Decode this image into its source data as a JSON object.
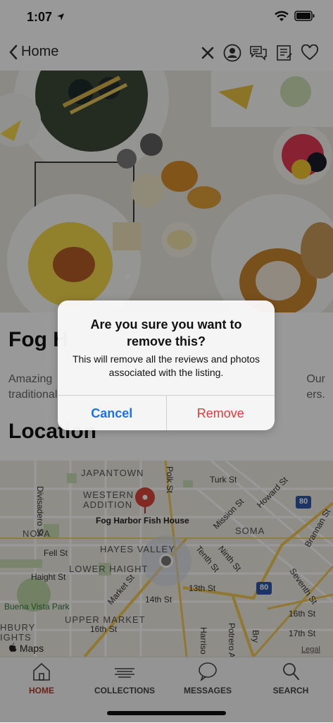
{
  "status": {
    "time": "1:07"
  },
  "nav": {
    "back_label": "Home"
  },
  "listing": {
    "title": "Fog H",
    "description_left_1": "Amazing",
    "description_right_1": "Our",
    "description_left_2": "traditional",
    "description_right_2": "ers.",
    "section_location": "Location"
  },
  "map": {
    "labels": {
      "japantown": "JAPANTOWN",
      "western_addition": "WESTERN\nADDITION",
      "fog_harbor": "Fog Harbor Fish House",
      "nopa": "NOPA",
      "hayes_valley": "HAYES VALLEY",
      "lower_haight": "LOWER HAIGHT",
      "soma": "SOMA",
      "upper_market": "UPPER MARKET",
      "buena_vista": "Buena Vista Park",
      "ashbury": "HBURY\nIGHTS",
      "divisadero": "Divisadero St",
      "fell": "Fell St",
      "haight": "Haight St",
      "market": "Market St",
      "fourteenth": "14th St",
      "sixteenth_left": "16th St",
      "sixteenth_right": "16th St",
      "thirteenth": "13th St",
      "polk": "Polk St",
      "turk": "Turk St",
      "mission": "Mission St",
      "howard": "Howard St",
      "ninth": "Ninth St",
      "tenth": "Tenth St",
      "brannan": "Brannan St",
      "seventh": "Seventh St",
      "potrero": "Potrero Av",
      "harrison": "Harriso",
      "bryant": "Bry",
      "seventeenth": "17th St",
      "i80_a": "80",
      "i80_b": "80",
      "maps": "Maps",
      "legal": "Legal"
    }
  },
  "tabs": [
    {
      "label": "HOME",
      "icon": "home-icon"
    },
    {
      "label": "COLLECTIONS",
      "icon": "collections-icon"
    },
    {
      "label": "MESSAGES",
      "icon": "messages-icon"
    },
    {
      "label": "SEARCH",
      "icon": "search-icon"
    }
  ],
  "alert": {
    "title": "Are you sure you want to remove this?",
    "message": "This will remove all the reviews and photos associated with the listing.",
    "cancel_label": "Cancel",
    "remove_label": "Remove"
  },
  "colors": {
    "accent_active_tab": "#b23a2a",
    "alert_cancel": "#1a73e8",
    "alert_remove": "#e53935",
    "map_pin": "#d9473a"
  }
}
